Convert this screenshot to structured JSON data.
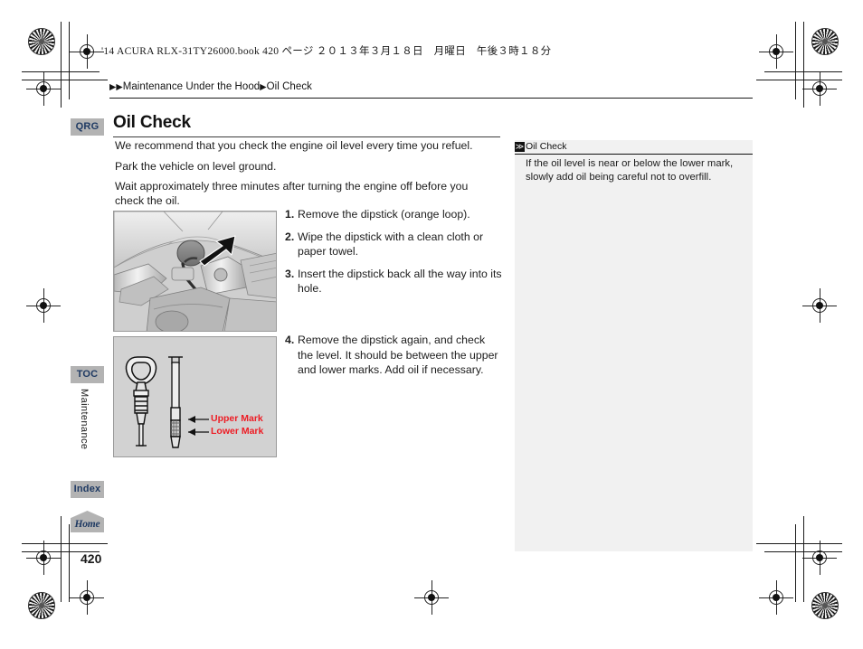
{
  "print_slug": "'14 ACURA RLX-31TY26000.book  420 ページ  ２０１３年３月１８日　月曜日　午後３時１８分",
  "breadcrumb": {
    "arrow": "▶",
    "level1": "Maintenance Under the Hood",
    "level2": "Oil Check"
  },
  "sidebar": {
    "qrg_label": "QRG",
    "toc_label": "TOC",
    "index_label": "Index",
    "home_label": "Home",
    "chapter_label": "Maintenance"
  },
  "page_number": "420",
  "main": {
    "title": "Oil Check",
    "paragraphs": [
      "We recommend that you check the engine oil level every time you refuel.",
      "Park the vehicle on level ground.",
      "Wait approximately three minutes after turning the engine off before you check the oil."
    ],
    "steps_group_a": [
      {
        "num": "1.",
        "text": "Remove the dipstick (orange loop)."
      },
      {
        "num": "2.",
        "text": "Wipe the dipstick with a clean cloth or paper towel."
      },
      {
        "num": "3.",
        "text": "Insert the dipstick back all the way into its hole."
      }
    ],
    "steps_group_b": [
      {
        "num": "4.",
        "text": "Remove the dipstick again, and check the level. It should be between the upper and lower marks. Add oil if necessary."
      }
    ],
    "figure_labels": {
      "upper_mark": "Upper Mark",
      "lower_mark": "Lower Mark"
    }
  },
  "note": {
    "icon_glyph": "≫",
    "heading": "Oil Check",
    "body": "If the oil level is near or below the lower mark, slowly add oil being careful not to overfill."
  },
  "colors": {
    "label_red": "#ED1C24",
    "tab_navy": "#1F3A63",
    "tab_gray": "#B3B3B3",
    "note_bg": "#F1F1F1"
  }
}
